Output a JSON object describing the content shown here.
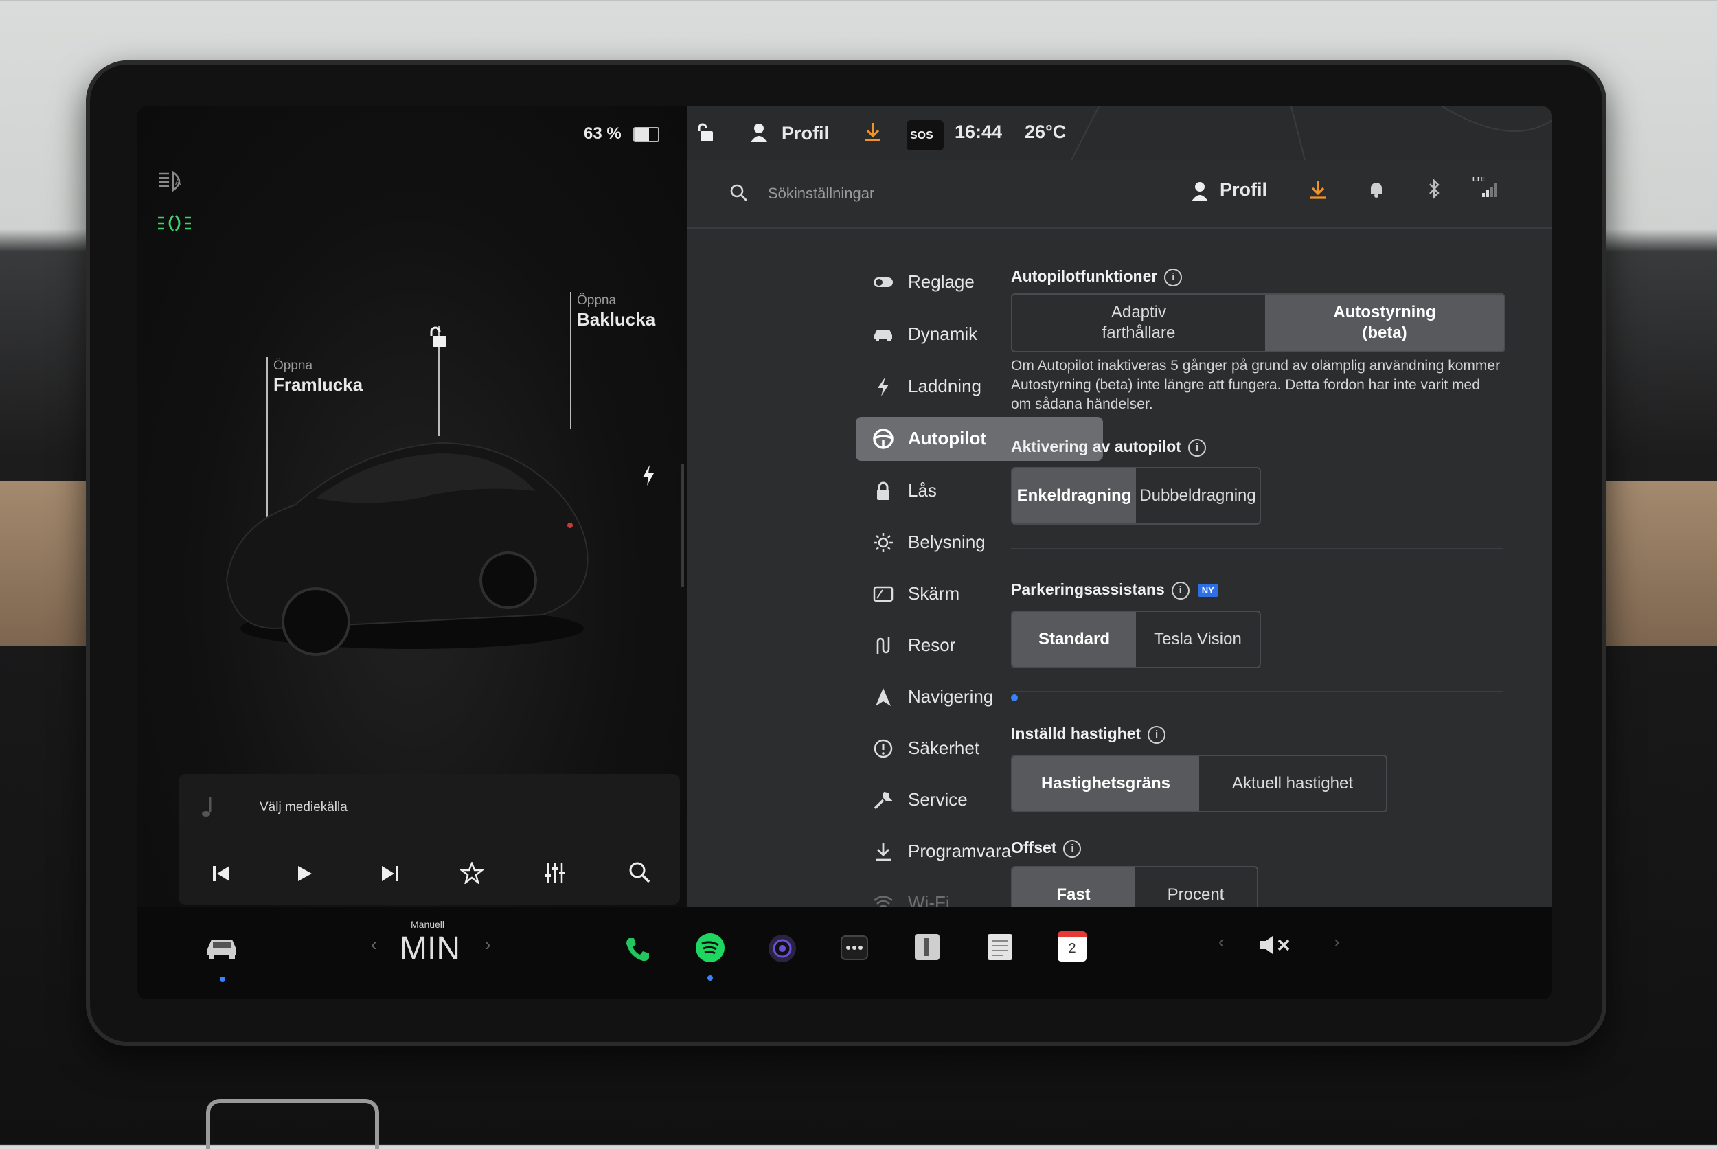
{
  "status": {
    "battery": "63 %",
    "profile_label": "Profil",
    "sos": "SOS",
    "time": "16:44",
    "temperature": "26°C",
    "lte": "LTE"
  },
  "car": {
    "frunk_small": "Öppna",
    "frunk_label": "Framlucka",
    "trunk_small": "Öppna",
    "trunk_label": "Baklucka"
  },
  "media": {
    "source_label": "Välj mediekälla"
  },
  "settings": {
    "search_placeholder": "Sökinställningar",
    "profile_label": "Profil",
    "menu": [
      {
        "label": "Reglage",
        "icon": "toggle-icon"
      },
      {
        "label": "Dynamik",
        "icon": "car-icon"
      },
      {
        "label": "Laddning",
        "icon": "bolt-icon"
      },
      {
        "label": "Autopilot",
        "icon": "steering-wheel-icon"
      },
      {
        "label": "Lås",
        "icon": "lock-icon"
      },
      {
        "label": "Belysning",
        "icon": "sun-icon"
      },
      {
        "label": "Skärm",
        "icon": "display-icon"
      },
      {
        "label": "Resor",
        "icon": "trips-icon"
      },
      {
        "label": "Navigering",
        "icon": "navigation-icon"
      },
      {
        "label": "Säkerhet",
        "icon": "safety-icon"
      },
      {
        "label": "Service",
        "icon": "wrench-icon"
      },
      {
        "label": "Programvara",
        "icon": "download-icon"
      },
      {
        "label": "Wi-Fi",
        "icon": "wifi-icon"
      }
    ],
    "autopilot_features": {
      "title": "Autopilotfunktioner",
      "option_a": "Adaptiv farthållare",
      "option_b": "Autostyrning (beta)",
      "note": "Om Autopilot inaktiveras 5 gånger på grund av olämplig användning kommer Autostyrning (beta) inte längre att fungera. Detta fordon har inte varit med om sådana händelser."
    },
    "activation": {
      "title": "Aktivering av autopilot",
      "option_a": "Enkeldragning",
      "option_b": "Dubbeldragning"
    },
    "parking": {
      "title": "Parkeringsassistans",
      "badge": "NY",
      "option_a": "Standard",
      "option_b": "Tesla Vision"
    },
    "speed": {
      "title": "Inställd hastighet",
      "option_a": "Hastighetsgräns",
      "option_b": "Aktuell hastighet"
    },
    "offset": {
      "title": "Offset",
      "option_a": "Fast",
      "option_b": "Procent"
    }
  },
  "taskbar": {
    "climate_small": "Manuell",
    "climate_value": "MIN",
    "calendar_day": "2"
  },
  "colors": {
    "accent_orange": "#f0932b",
    "light_green": "#3fd16a",
    "nav_dot_blue": "#3a82f7",
    "badge_blue": "#2f6fe4",
    "spotify_green": "#1ed760"
  }
}
